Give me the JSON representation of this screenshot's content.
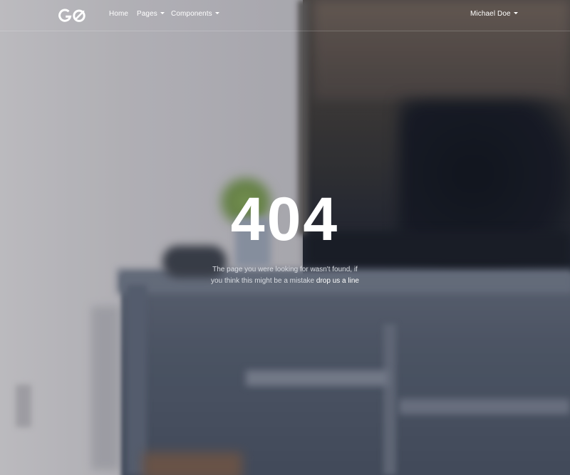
{
  "navbar": {
    "brand_name": "GO",
    "links": [
      {
        "label": "Home",
        "dropdown": false
      },
      {
        "label": "Pages",
        "dropdown": true
      },
      {
        "label": "Components",
        "dropdown": true
      }
    ],
    "user": {
      "label": "Michael Doe",
      "dropdown": true
    }
  },
  "error": {
    "code": "404",
    "message_line1": "The page you were looking for wasn't found, if",
    "message_line2": "you think this might be a mistake",
    "contact_link": "drop us a line"
  },
  "colors": {
    "text": "#ffffff",
    "muted_text": "#d9dce2",
    "background_tint": "#4f5868"
  },
  "icons": {
    "brand": "go-logo-icon",
    "dropdown": "caret-down-icon"
  }
}
